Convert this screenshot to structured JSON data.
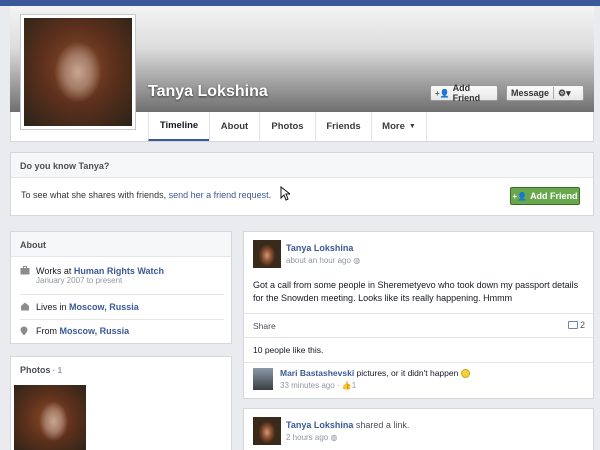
{
  "profile": {
    "name": "Tanya Lokshina",
    "add_friend": "Add Friend",
    "message": "Message"
  },
  "tabs": [
    "Timeline",
    "About",
    "Photos",
    "Friends",
    "More"
  ],
  "know": {
    "title": "Do you know Tanya?",
    "text_before": "To see what she shares with friends, ",
    "link": "send her a friend request",
    "text_after": ".",
    "button": "Add Friend"
  },
  "about": {
    "title": "About",
    "work_prefix": "Works at ",
    "work_org": "Human Rights Watch",
    "work_dates": "January 2007 to present",
    "lives_prefix": "Lives in ",
    "lives_place": "Moscow, Russia",
    "from_prefix": "From ",
    "from_place": "Moscow, Russia"
  },
  "photos": {
    "title": "Photos",
    "count": "1"
  },
  "post1": {
    "author": "Tanya Lokshina",
    "time": "about an hour ago",
    "text": "Got a call from some people in Sheremetyevo who took down my passport details for the Snowden meeting. Looks like its really happening. Hmmm",
    "share": "Share",
    "comments": "2",
    "likes": "10 people like this.",
    "commenter": "Mari Bastashevski",
    "comment": " pictures, or it didn't happen ",
    "comment_time": "33 minutes ago",
    "comment_likes": "1"
  },
  "post2": {
    "author": "Tanya Lokshina",
    "action": " shared a link.",
    "time": "2 hours ago"
  },
  "colors": {
    "brand": "#3b5998",
    "green": "#69a74e"
  }
}
